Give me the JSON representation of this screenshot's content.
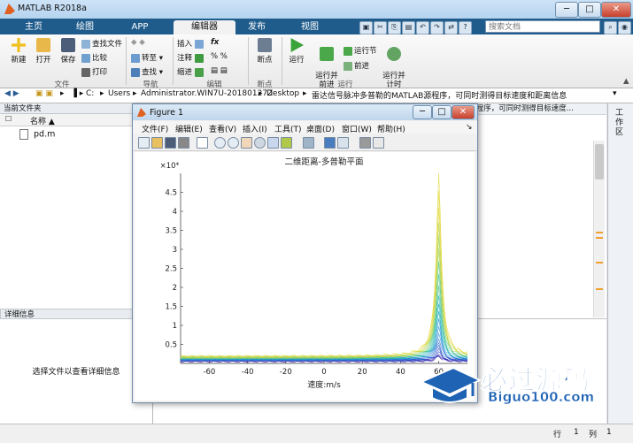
{
  "window": {
    "title": "MATLAB R2018a",
    "min": "─",
    "max": "□",
    "close": "✕"
  },
  "ribbon_tabs": [
    "主页",
    "绘图",
    "APP",
    "编辑器",
    "发布",
    "视图"
  ],
  "search": {
    "placeholder": "搜索文档"
  },
  "ribbon": {
    "file": {
      "new": "新建",
      "open": "打开",
      "save": "保存",
      "find_files": "查找文件",
      "compare": "比较",
      "print": "打印",
      "label": "文件"
    },
    "navigate": {
      "goto": "转至",
      "find": "查找",
      "label": "导航"
    },
    "edit": {
      "insert": "插入",
      "comment": "注释",
      "indent": "缩进",
      "fx": "fx",
      "label": "编辑"
    },
    "breakpoints": {
      "breakpoint": "断点",
      "label": "断点"
    },
    "run": {
      "run": "运行",
      "run_advance": "运行并\n前进",
      "run_section": "运行节",
      "advance": "前进",
      "run_time": "运行并\n计时",
      "label": "运行"
    }
  },
  "address": {
    "path": [
      "C:",
      "Users",
      "Administrator.WIN7U-20180127Z",
      "Desktop",
      "雷达信号脉冲多普勒的MATLAB源程序，可同时测得目标速度和距离信息"
    ]
  },
  "current_folder": {
    "title": "当前文件夹",
    "name_col": "名称 ▲",
    "files": [
      "pd.m"
    ]
  },
  "details": {
    "title": "详细信息",
    "hint": "选择文件以查看详细信息"
  },
  "editor_strip": "器 - C:\\Users\\Administrator.WIN7U-20180127Z\\Desktop\\雷达信号脉冲多普勒的MATLAB源程序，可同时测得目标速度...",
  "workspace_label": "工作区",
  "status": {
    "row_label": "行",
    "row": "1",
    "col_label": "列",
    "col": "1"
  },
  "figure": {
    "title": "Figure 1",
    "menu": [
      "文件(F)",
      "编辑(E)",
      "查看(V)",
      "插入(I)",
      "工具(T)",
      "桌面(D)",
      "窗口(W)",
      "帮助(H)"
    ]
  },
  "chart_data": {
    "type": "line",
    "title": "二维距离-多普勒平面",
    "xlabel": "速度:m/s",
    "ylabel": "",
    "y_exponent": "×10⁴",
    "xlim": [
      -75,
      75
    ],
    "ylim": [
      0,
      5
    ],
    "xticks": [
      -60,
      -40,
      -20,
      0,
      20,
      40,
      60
    ],
    "yticks": [
      0.5,
      1,
      1.5,
      2,
      2.5,
      3,
      3.5,
      4,
      4.5
    ],
    "peak": {
      "x": 60,
      "y": 48000
    },
    "baseline": 1500,
    "colors": [
      "#3b1fa8",
      "#2f3fc0",
      "#2860d0",
      "#1f8ad6",
      "#18aeb8",
      "#47c490",
      "#a8d24a",
      "#e2d83a"
    ]
  },
  "watermark": {
    "cn": "必过源码",
    "en": "Biguo100.com"
  }
}
